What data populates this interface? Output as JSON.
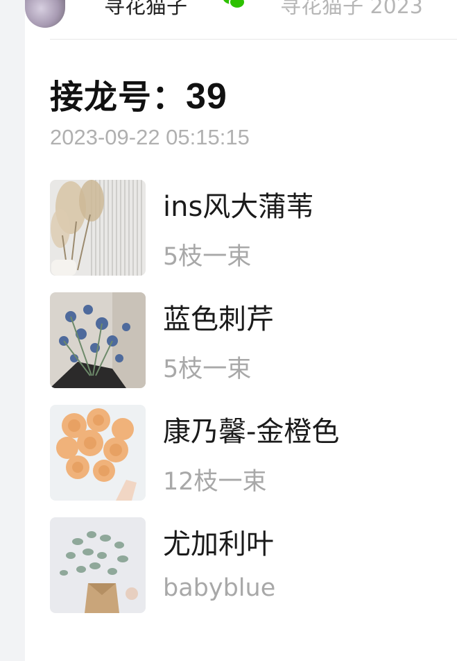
{
  "header": {
    "nickname": "寻花猫子",
    "join_text": "寻花猫子 2023",
    "accent": "#2dc100"
  },
  "solitaire": {
    "title_label": "接龙号：",
    "number": "39",
    "timestamp": "2023-09-22 05:15:15"
  },
  "items": [
    {
      "name": "ins风大蒲苇",
      "desc": "5枝一束",
      "thumb_icon": "pampas-grass-photo"
    },
    {
      "name": "蓝色刺芹",
      "desc": "5枝一束",
      "thumb_icon": "blue-eryngium-photo"
    },
    {
      "name": "康乃馨-金橙色",
      "desc": "12枝一束",
      "thumb_icon": "orange-carnation-photo"
    },
    {
      "name": "尤加利叶",
      "desc": "babyblue",
      "thumb_icon": "eucalyptus-photo"
    }
  ],
  "colors": {
    "gutter": "#f2f3f5",
    "text_primary": "#1a1a1a",
    "text_secondary": "#a8a8a8"
  }
}
